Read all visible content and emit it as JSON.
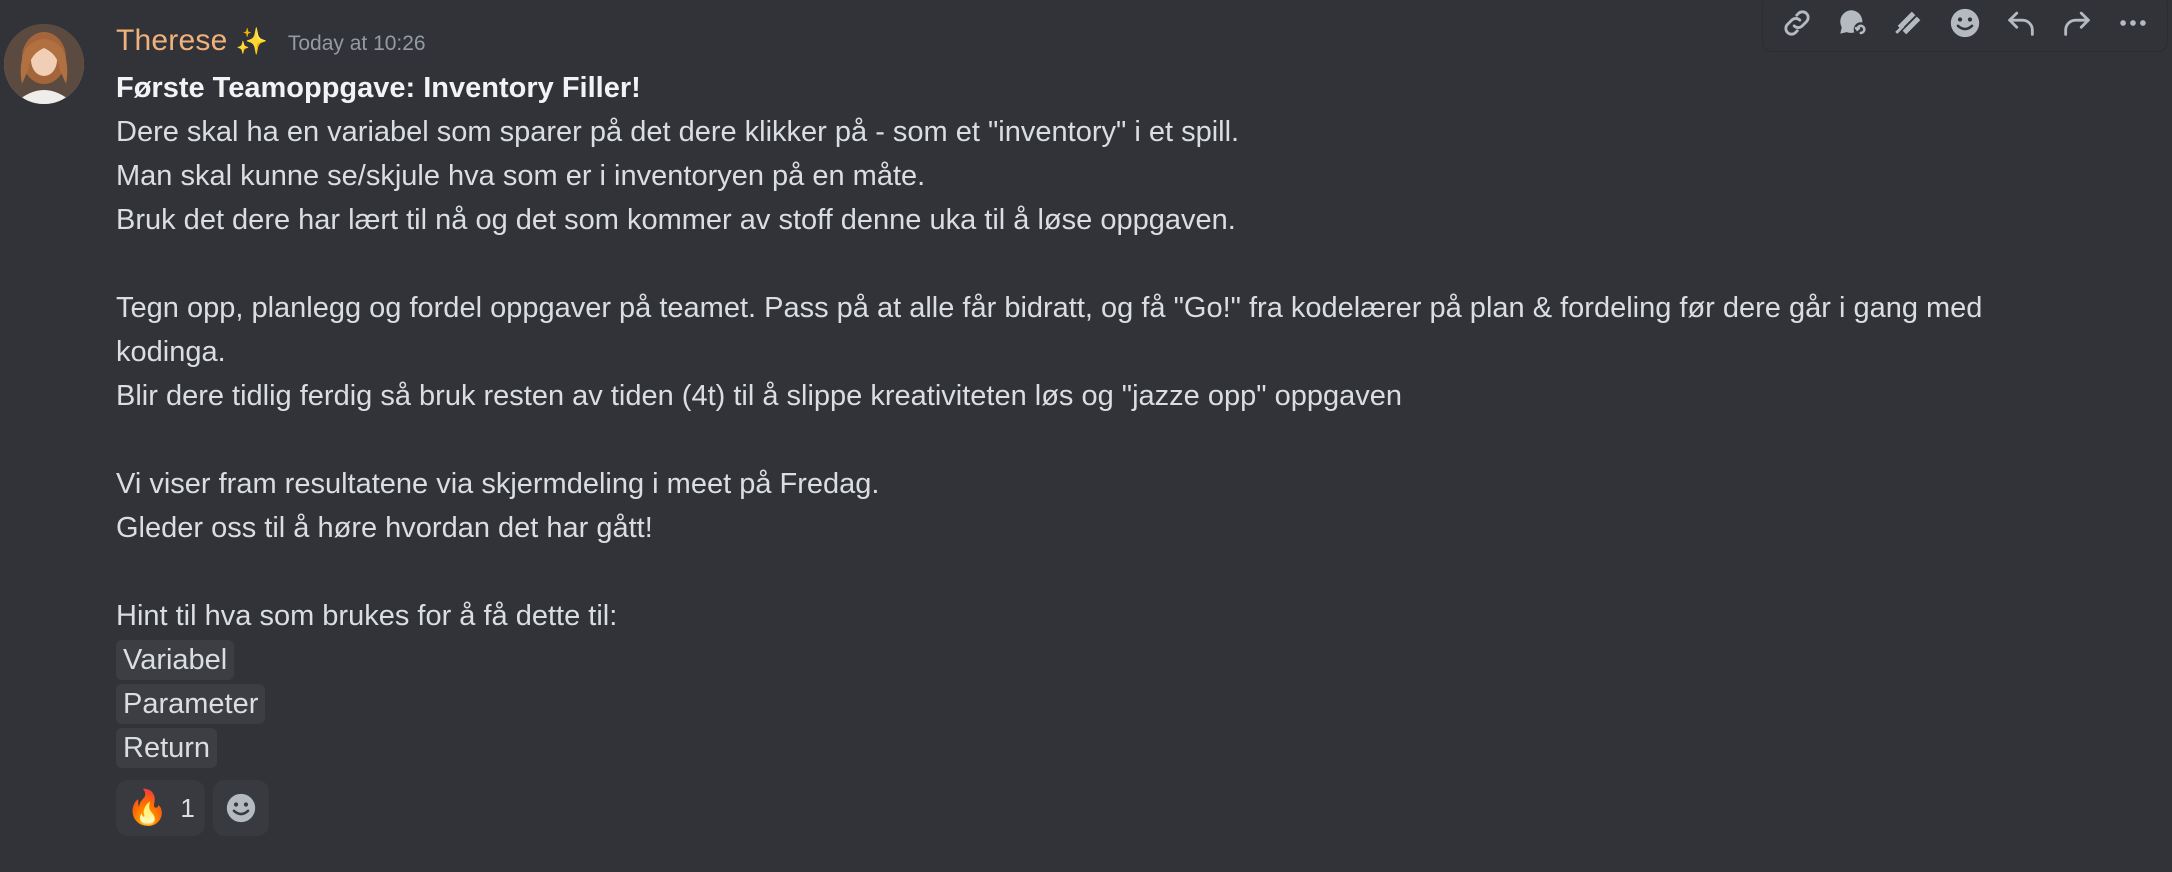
{
  "author": {
    "name": "Therese",
    "badge": "✨",
    "timestamp": "Today at 10:26"
  },
  "message": {
    "title": "Første Teamoppgave: Inventory Filler!",
    "lines": [
      "Dere skal ha en variabel som sparer på det dere klikker på - som et \"inventory\" i et spill.",
      "Man skal kunne se/skjule hva som er i inventoryen på en måte.",
      "Bruk det dere har lært til nå og det som kommer av stoff denne uka til å løse oppgaven.",
      "",
      "Tegn opp, planlegg og fordel oppgaver på teamet. Pass på at alle får bidratt, og få \"Go!\" fra kodelærer på plan & fordeling før dere går i gang med",
      "kodinga.",
      "Blir dere tidlig ferdig så bruk resten av tiden (4t) til å slippe kreativiteten løs og \"jazze opp\" oppgaven",
      "",
      "Vi viser fram resultatene via skjermdeling i meet på Fredag.",
      "Gleder oss til å høre hvordan det har gått!",
      "",
      "Hint til hva som brukes for å få dette til:"
    ],
    "code_items": [
      "Variabel",
      "Parameter",
      "Return"
    ]
  },
  "reactions": [
    {
      "emoji": "🔥",
      "count": "1"
    }
  ],
  "toolbar": {
    "icons": [
      "link-icon",
      "thread-icon",
      "app-icon",
      "emoji-icon",
      "reply-icon",
      "forward-icon",
      "more-icon"
    ]
  }
}
